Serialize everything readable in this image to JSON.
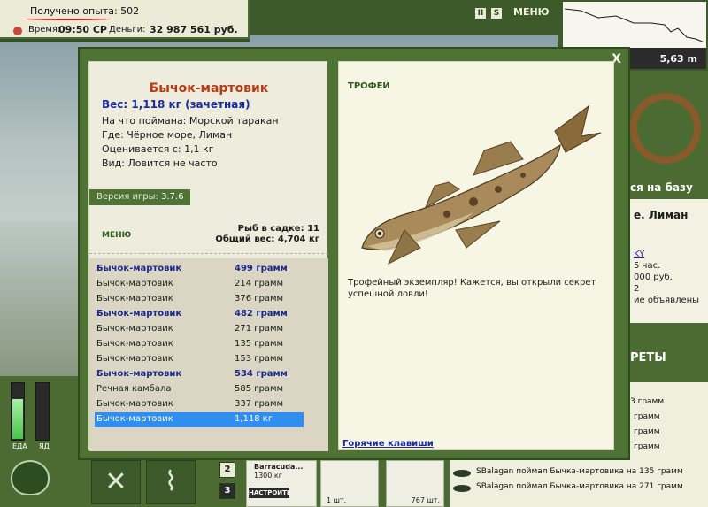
{
  "status": {
    "experience_label": "Получено опыта: 502",
    "time_label": "Время:",
    "time_value": "09:50 СР",
    "money_label": "Деньги:",
    "money_value": "32 987 561 руб."
  },
  "top_controls": {
    "pause_label": "II",
    "sound_label": "S",
    "menu_label": "МЕНЮ"
  },
  "depth": {
    "value": "5,63 m"
  },
  "right_side": {
    "base_button": "ся на базу",
    "location": "е. Лиман",
    "info_lines": [
      "KY",
      "5 час.",
      "000 руб.",
      "2",
      "ие объявлены"
    ],
    "secrets_label": "РЕТЫ"
  },
  "chat": {
    "lines": [
      {
        "text": "3 грамм"
      },
      {
        "text": "грамм"
      },
      {
        "text": "грамм"
      },
      {
        "text": "грамм"
      },
      {
        "text": "SBalagan поймал Бычка-мартовика на 135 грамм"
      },
      {
        "text": "SBalagan поймал Бычка-мартовика на 271 грамм"
      }
    ]
  },
  "hud": {
    "food_label": "ЕДА",
    "poison_label": "ЯД",
    "food_level": 0.7,
    "poison_level": 0.0
  },
  "bottom_bar": {
    "slot2": "2",
    "slot3": "3",
    "rod_name": "Barracuda...",
    "rod_weight": "1300 кг",
    "setup_button": "НАСТРОИТЬ",
    "bait1_count": "1 шт.",
    "bait2_count": "767 шт."
  },
  "modal": {
    "close_label": "X",
    "fish_name": "Бычок-мартовик",
    "weight": "Вес: 1,118 кг (зачетная)",
    "caught_on": "На что поймана: Морской таракан",
    "location": "Где: Чёрное море, Лиман",
    "valued_from": "Оценивается с: 1,1 кг",
    "species": "Вид: Ловится не часто",
    "version_label": "Версия игры:",
    "version_value": "3.7.6",
    "menu_label": "МЕНЮ",
    "keepnet_count": "Рыб в садке: 11",
    "keepnet_total": "Общий вес: 4,704 кг",
    "trophy_label": "ТРОФЕЙ",
    "trophy_text": "Трофейный экземпляр! Кажется, вы открыли секрет успешной ловли!",
    "hotkeys_label": "Горячие клавиши",
    "catch_list": [
      {
        "name": "Бычок-мартовик",
        "weight": "499 грамм",
        "style": "highlight"
      },
      {
        "name": "Бычок-мартовик",
        "weight": "214 грамм",
        "style": ""
      },
      {
        "name": "Бычок-мартовик",
        "weight": "376 грамм",
        "style": ""
      },
      {
        "name": "Бычок-мартовик",
        "weight": "482 грамм",
        "style": "highlight"
      },
      {
        "name": "Бычок-мартовик",
        "weight": "271 грамм",
        "style": ""
      },
      {
        "name": "Бычок-мартовик",
        "weight": "135 грамм",
        "style": ""
      },
      {
        "name": "Бычок-мартовик",
        "weight": "153 грамм",
        "style": ""
      },
      {
        "name": "Бычок-мартовик",
        "weight": "534 грамм",
        "style": "highlight"
      },
      {
        "name": "Речная камбала",
        "weight": "585 грамм",
        "style": ""
      },
      {
        "name": "Бычок-мартовик",
        "weight": "337 грамм",
        "style": ""
      },
      {
        "name": "Бычок-мартовик",
        "weight": "1,118 кг",
        "style": "selected"
      }
    ]
  }
}
